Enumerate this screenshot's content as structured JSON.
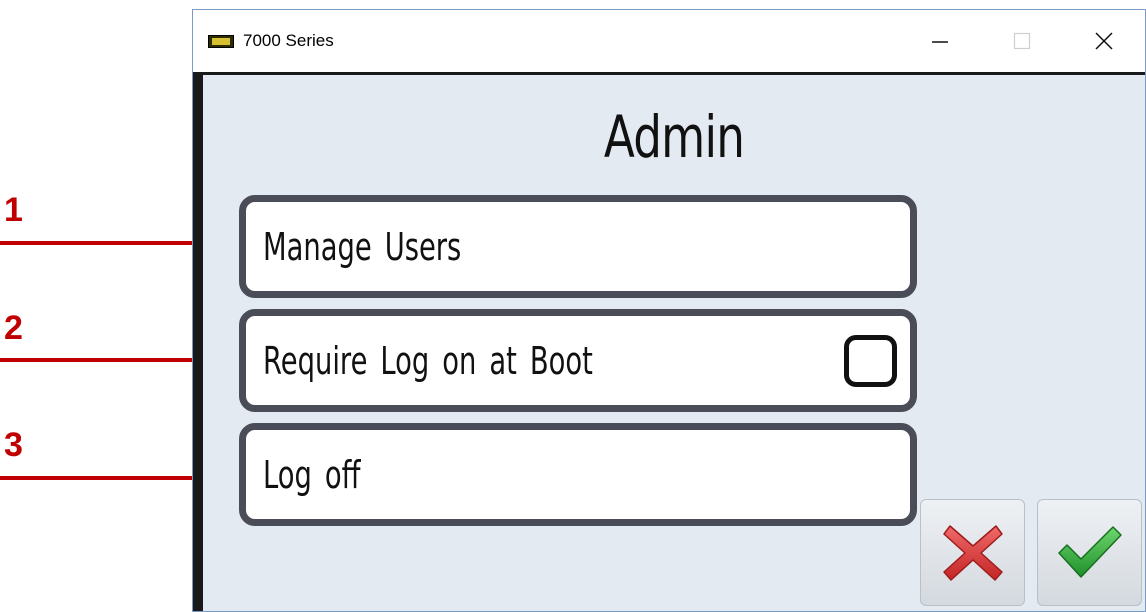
{
  "annotations": {
    "callouts": [
      {
        "number": "1",
        "color": "#c00000"
      },
      {
        "number": "2",
        "color": "#c00000"
      },
      {
        "number": "3",
        "color": "#c00000"
      }
    ]
  },
  "window": {
    "title": "7000 Series",
    "app_icon": "7000-series-app-icon",
    "controls": {
      "minimize_icon": "minimize-icon",
      "maximize_icon": "maximize-icon",
      "close_icon": "close-icon"
    }
  },
  "screen": {
    "title": "Admin",
    "menu_items": [
      {
        "label": "Manage Users"
      },
      {
        "label": "Require Log on at Boot",
        "checkbox_checked": false
      },
      {
        "label": "Log off"
      }
    ],
    "actions": {
      "cancel_icon": "cancel-x-icon",
      "cancel_color": "#d93a3a",
      "confirm_icon": "confirm-check-icon",
      "confirm_color": "#2fa83a"
    }
  },
  "colors": {
    "client_background": "#e4eaf1",
    "menu_border": "#4a4c57",
    "frame_dark": "#1a1a1a"
  }
}
